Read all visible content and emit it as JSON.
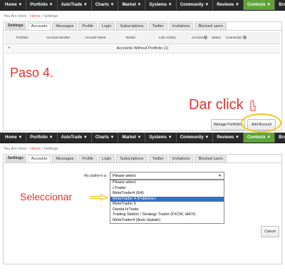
{
  "nav": [
    {
      "label": "Home ▼",
      "active": false
    },
    {
      "label": "Portfolio ▼",
      "active": false
    },
    {
      "label": "AutoTrade ▼",
      "active": false
    },
    {
      "label": "Charts ▼",
      "active": false
    },
    {
      "label": "Market ▼",
      "active": false
    },
    {
      "label": "Systems ▼",
      "active": false
    },
    {
      "label": "Community ▼",
      "active": false
    },
    {
      "label": "Reviews ▼",
      "active": false
    },
    {
      "label": "Contests ▼",
      "active": true
    },
    {
      "label": "Brokers ▼",
      "active": false
    }
  ],
  "breadcrumb": {
    "prefix": "You Are Here :",
    "link": "Home",
    "separator": "/",
    "current": "Settings"
  },
  "tabs": [
    {
      "label": "Settings",
      "kind": "settings"
    },
    {
      "label": "Accounts",
      "kind": "active"
    },
    {
      "label": "Messages",
      "kind": "tab"
    },
    {
      "label": "Profile",
      "kind": "tab"
    },
    {
      "label": "Login",
      "kind": "tab"
    },
    {
      "label": "Subscriptions",
      "kind": "tab"
    },
    {
      "label": "Twitter",
      "kind": "tab"
    },
    {
      "label": "Invitations",
      "kind": "tab"
    },
    {
      "label": "Blocked users",
      "kind": "tab"
    }
  ],
  "table": {
    "headers": [
      "Portfolio",
      "Account Number",
      "Account Name",
      "Broker",
      "Last Activity",
      "Account",
      "Status",
      "Connection"
    ],
    "group_row": "Accounts Without Portfolio (1)",
    "expand_symbol": "+",
    "sort_symbol": "?"
  },
  "annotations": {
    "step": "Paso 4.",
    "dar_click": "Dar click",
    "seleccionar": "Seleccionar",
    "accent_color": "#e8322a",
    "highlight_color": "#f2c518"
  },
  "buttons": {
    "manage_portfolios": "Manage Portfolios",
    "add_account": "Add Account",
    "cancel": "Cancel"
  },
  "form": {
    "platform_label": "My platform is:",
    "selected_value": "Please select",
    "options": [
      {
        "label": "Please select",
        "selected": false
      },
      {
        "label": "cTrader",
        "selected": false
      },
      {
        "label": "MetaTrader4 (EA)",
        "selected": false
      },
      {
        "label": "MetaTrader 4 (Publisher)",
        "selected": true
      },
      {
        "label": "MetaTrader 5",
        "selected": false
      },
      {
        "label": "Oanda fxTrade",
        "selected": false
      },
      {
        "label": "Trading Station / Strategy Trader (FXCM, dbFX)",
        "selected": false
      },
      {
        "label": "MetaTrader4 (Auto Update)",
        "selected": false
      }
    ]
  },
  "colors": {
    "nav_bg": "#2a2a2a",
    "active_nav": "#5fa33a",
    "link": "#d9534f",
    "selected_option": "#3370c4"
  }
}
